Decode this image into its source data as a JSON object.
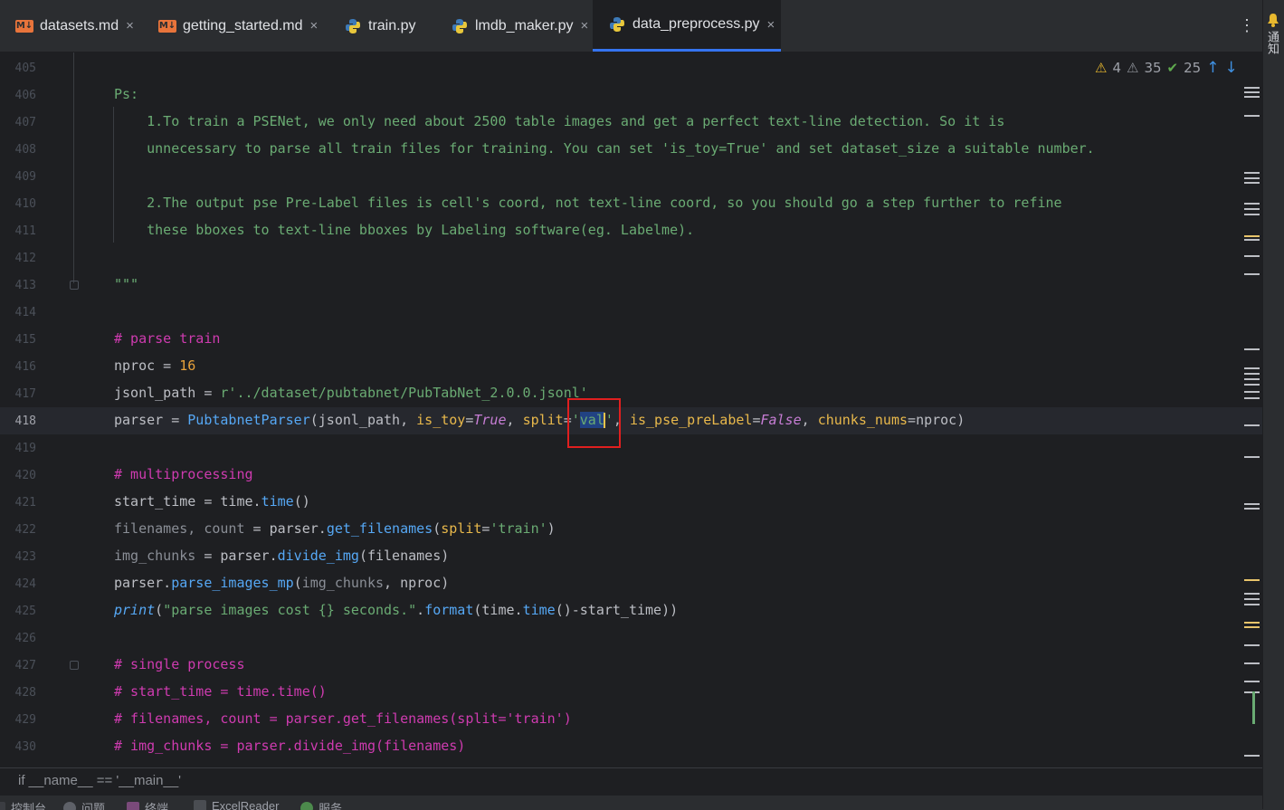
{
  "tabs": [
    {
      "label": "datasets.md",
      "icon": "markdown-icon",
      "active": false
    },
    {
      "label": "getting_started.md",
      "icon": "markdown-icon",
      "active": false
    },
    {
      "label": "train.py",
      "icon": "python-icon",
      "active": false
    },
    {
      "label": "lmdb_maker.py",
      "icon": "python-icon",
      "active": false
    },
    {
      "label": "data_preprocess.py",
      "icon": "python-icon",
      "active": true
    }
  ],
  "md_icon_text": "M↓",
  "tab_actions_icon": "more-vertical-icon",
  "notifications": {
    "label": "通知"
  },
  "inspections": {
    "warnings": "4",
    "weak_warnings": "35",
    "typos": "25"
  },
  "line_numbers": [
    "405",
    "406",
    "407",
    "408",
    "409",
    "410",
    "411",
    "412",
    "413",
    "414",
    "415",
    "416",
    "417",
    "418",
    "419",
    "420",
    "421",
    "422",
    "423",
    "424",
    "425",
    "426",
    "427",
    "428",
    "429",
    "430"
  ],
  "code": {
    "l406": "Ps:",
    "l407": "    1.To train a PSENet, we only need about 2500 table images and get a perfect text-line detection. So it is",
    "l408": "    unnecessary to parse all train files for training. You can set 'is_toy=True' and set dataset_size a suitable number.",
    "l410": "    2.The output pse Pre-Label files is cell's coord, not text-line coord, so you should go a step further to refine",
    "l411": "    these bboxes to text-line bboxes by Labeling software(eg. Labelme).",
    "l413": "\"\"\"",
    "l415": "# parse train",
    "l416_var": "nproc",
    "l416_eq": " = ",
    "l416_num": "16",
    "l417_var": "jsonl_path",
    "l417_eq": " = ",
    "l417_str": "r'../dataset/pubtabnet/PubTabNet_2.0.0.jsonl'",
    "l418_var": "parser",
    "l418_eq": " = ",
    "l418_cls": "PubtabnetParser",
    "l418_a": "(jsonl_path, ",
    "l418_p1": "is_toy",
    "l418_e1": "=",
    "l418_k1": "True",
    "l418_c1": ", ",
    "l418_p2": "split",
    "l418_e2": "=",
    "l418_q1": "'",
    "l418_val": "val",
    "l418_q2": "'",
    "l418_c2": ", ",
    "l418_p3": "is_pse_preLabel",
    "l418_e3": "=",
    "l418_k3": "False",
    "l418_c3": ", ",
    "l418_p4": "chunks_nums",
    "l418_e4": "=",
    "l418_end": "nproc)",
    "l420": "# multiprocessing",
    "l421_a": "start_time",
    "l421_b": " = time.",
    "l421_fn": "time",
    "l421_c": "()",
    "l422_a": "filenames, count",
    "l422_b": " = parser.",
    "l422_fn": "get_filenames",
    "l422_c": "(",
    "l422_p": "split",
    "l422_d": "=",
    "l422_s": "'train'",
    "l422_e": ")",
    "l423_a": "img_chunks",
    "l423_b": " = parser.",
    "l423_fn": "divide_img",
    "l423_c": "(filenames)",
    "l424_a": "parser.",
    "l424_fn": "parse_images_mp",
    "l424_b": "(",
    "l424_g": "img_chunks",
    "l424_c": ", nproc)",
    "l425_fn": "print",
    "l425_a": "(",
    "l425_s": "\"parse images cost {} seconds.\"",
    "l425_b": ".",
    "l425_fmt": "format",
    "l425_c": "(time.",
    "l425_t": "time",
    "l425_d": "()-start_time))",
    "l427": "# single process",
    "l428": "# start_time = time.time()",
    "l429": "# filenames, count = parser.get_filenames(split='train')",
    "l430": "# img_chunks = parser.divide_img(filenames)"
  },
  "breadcrumb": "if __name__ == '__main__'",
  "toolwindows": [
    "控制台",
    "问题",
    "终端",
    "ExcelReader",
    "服务"
  ]
}
